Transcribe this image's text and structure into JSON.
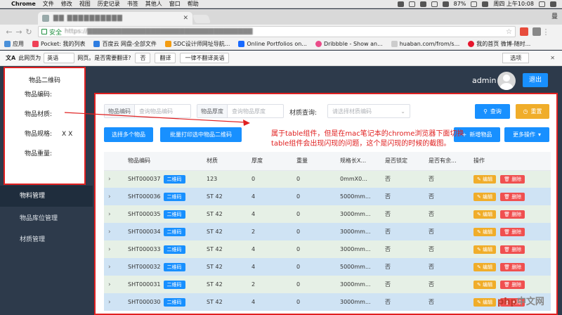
{
  "menubar": {
    "app": "Chrome",
    "menus": [
      "文件",
      "修改",
      "视图",
      "历史记录",
      "书签",
      "其他人",
      "窗口",
      "帮助"
    ],
    "battery": "87%",
    "clock": "周四 上午10:08"
  },
  "browser": {
    "tab_title": "▇▇ ▇▇▇▇▇▇▇▇▇▇",
    "profile": "曼",
    "secure_label": "安全",
    "url": "https://▇▇▇▇▇▇▇▇▇▇▇▇▇▇▇▇▇▇▇▇▇▇▇▇▇▇▇▇▇▇▇▇▇▇",
    "bookmarks": [
      "应用",
      "Pocket: 我的列表",
      "百度云 网盘-全部文件",
      "SDC设计师网址导航...",
      "Online Portfolios on...",
      "Dribbble - Show an...",
      "huaban.com/from/s...",
      "我的首页 微博-随时..."
    ],
    "translate": {
      "prefix": "此网页为",
      "language": "英语",
      "question": "网页。是否需要翻译?",
      "no": "否",
      "translate": "翻译",
      "never": "一律不翻译英语",
      "options": "选项"
    }
  },
  "header": {
    "user": "admin",
    "logout": "退出"
  },
  "sidebar": {
    "items": [
      "物料管理",
      "物品库位管理",
      "材质管理"
    ]
  },
  "popup": {
    "title": "物品二维码",
    "fields": [
      {
        "label": "物品编码:",
        "value": ""
      },
      {
        "label": "物品材质:",
        "value": ""
      },
      {
        "label": "物品规格:",
        "value": "X X"
      },
      {
        "label": "物品重量:",
        "value": ""
      }
    ]
  },
  "filters": {
    "code_label": "物品编码",
    "code_placeholder": "查询物品编码",
    "thick_label": "物品厚度",
    "thick_placeholder": "查询物品厚度",
    "material_label": "材质查询:",
    "material_placeholder": "请选择材质编码",
    "query": "查询",
    "reset": "重置"
  },
  "actions": {
    "select_multi": "选择多个物品",
    "batch_print": "批量打印选中物品二维码",
    "add": "新增物品",
    "more": "更多操作"
  },
  "annotation": "属于table组件，但是在mac笔记本的chrome浏览器下面切换table组件会出现闪现的问题，这个是闪现的时候的截图。",
  "table": {
    "headers": [
      "",
      "物品编码",
      "材质",
      "厚度",
      "重量",
      "规格长X...",
      "是否锁定",
      "是否有余...",
      "操作"
    ],
    "qr_label": "二维码",
    "edit_label": "编辑",
    "delete_label": "删除",
    "rows": [
      {
        "code": "SHT000037",
        "material": "123",
        "thickness": "0",
        "weight": "0",
        "spec": "0mmX0...",
        "locked": "否",
        "surplus": "否"
      },
      {
        "code": "SHT000036",
        "material": "ST 42",
        "thickness": "4",
        "weight": "0",
        "spec": "5000mm...",
        "locked": "否",
        "surplus": "否"
      },
      {
        "code": "SHT000035",
        "material": "ST 42",
        "thickness": "4",
        "weight": "0",
        "spec": "3000mm...",
        "locked": "否",
        "surplus": "否"
      },
      {
        "code": "SHT000034",
        "material": "ST 42",
        "thickness": "2",
        "weight": "0",
        "spec": "3000mm...",
        "locked": "否",
        "surplus": "否"
      },
      {
        "code": "SHT000033",
        "material": "ST 42",
        "thickness": "4",
        "weight": "0",
        "spec": "3000mm...",
        "locked": "否",
        "surplus": "否"
      },
      {
        "code": "SHT000032",
        "material": "ST 42",
        "thickness": "4",
        "weight": "0",
        "spec": "5000mm...",
        "locked": "否",
        "surplus": "否"
      },
      {
        "code": "SHT000031",
        "material": "ST 42",
        "thickness": "2",
        "weight": "0",
        "spec": "3000mm...",
        "locked": "否",
        "surplus": "否"
      },
      {
        "code": "SHT000030",
        "material": "ST 42",
        "thickness": "4",
        "weight": "0",
        "spec": "3000mm...",
        "locked": "否",
        "surplus": "否"
      }
    ]
  },
  "watermark": {
    "main": "php",
    "sub": "中文网"
  }
}
